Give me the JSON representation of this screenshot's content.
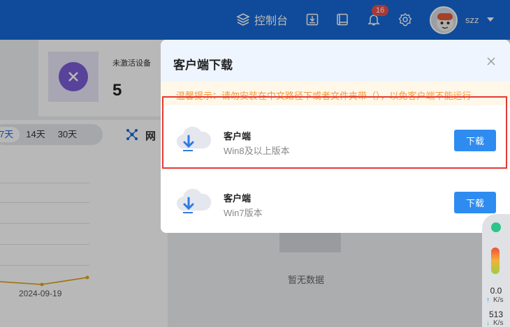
{
  "header": {
    "console_label": "控制台",
    "notification_count": "16",
    "username": "szz"
  },
  "background": {
    "stat_label": "未激活设备",
    "stat_value": "5",
    "range_tabs": [
      "7天",
      "14天",
      "30天"
    ],
    "net_label": "网",
    "chart_date": "2024-09-19",
    "empty_text": "暂无数据"
  },
  "modal": {
    "title": "客户端下载",
    "tip": "温馨提示：请勿安装在中文路径下或者文件夹带（），以免客户端不能运行",
    "items": [
      {
        "name": "客户端",
        "sub": "Win8及以上版本",
        "button": "下载"
      },
      {
        "name": "客户端",
        "sub": "Win7版本",
        "button": "下载"
      }
    ]
  },
  "speed": {
    "upload_value": "0.0",
    "upload_unit": "K/s",
    "download_value": "513",
    "download_unit": "K/s"
  }
}
